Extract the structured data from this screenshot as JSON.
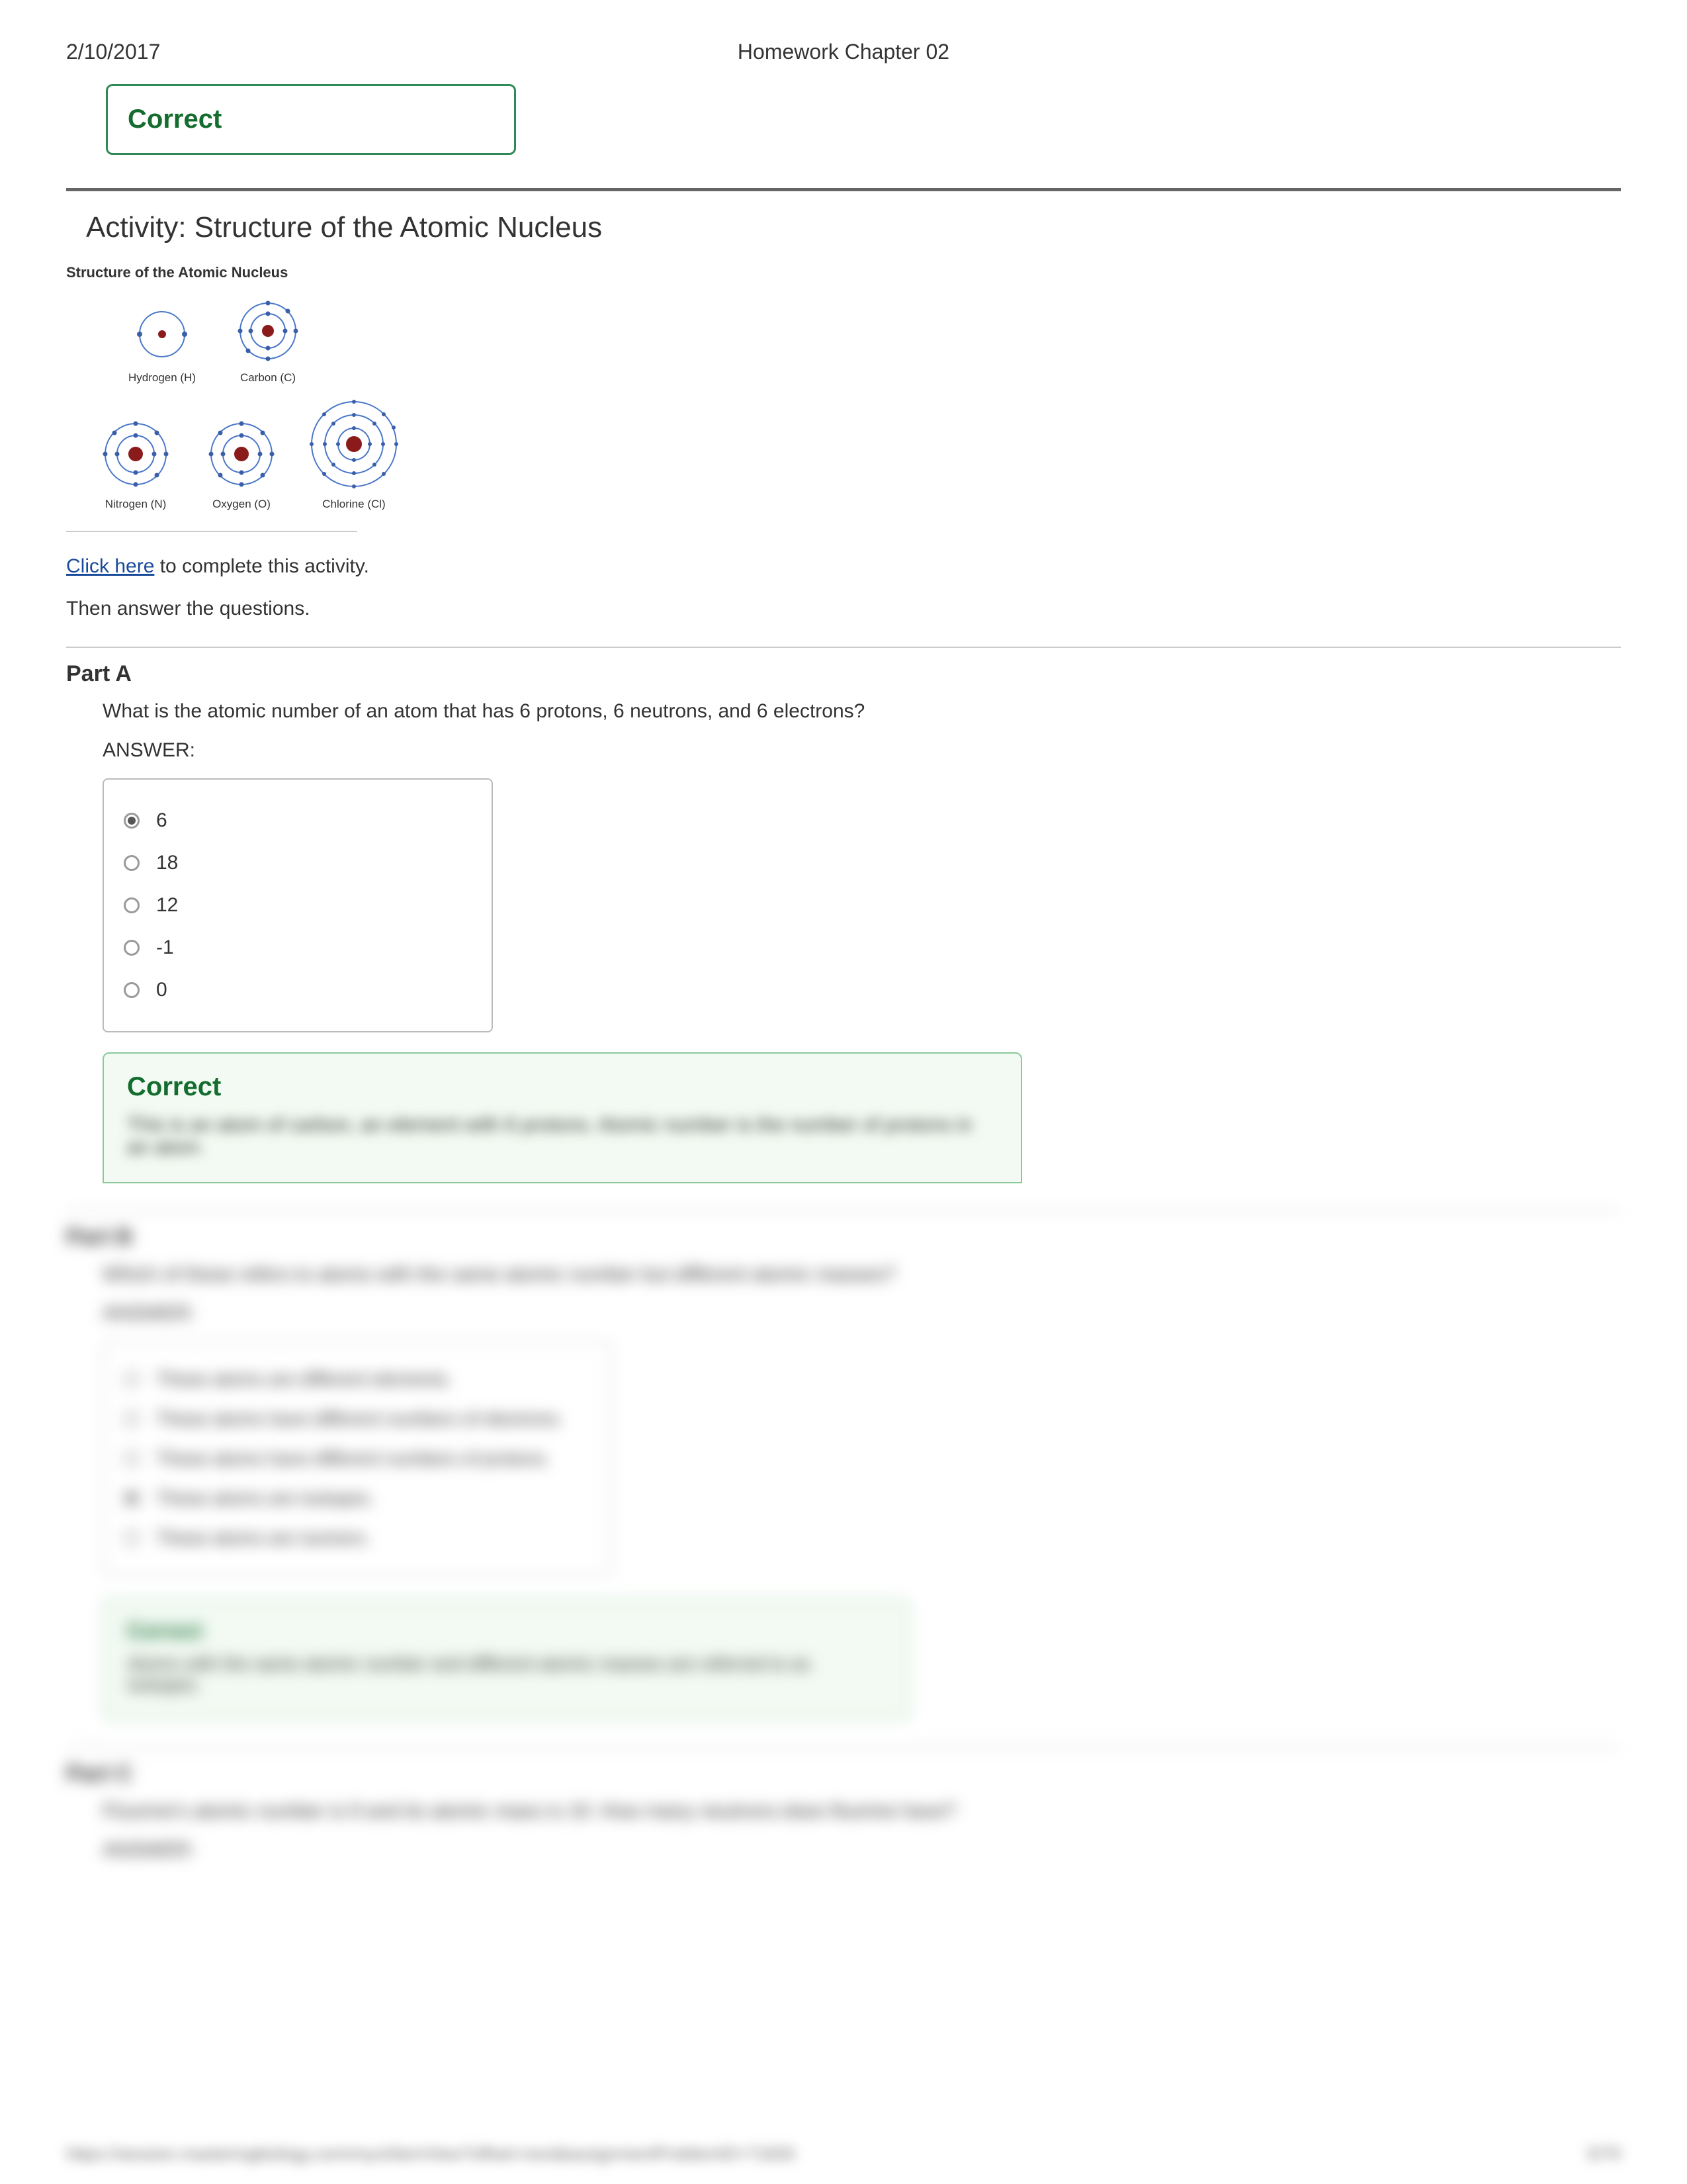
{
  "header": {
    "date": "2/10/2017",
    "title": "Homework Chapter 02"
  },
  "status_top": "Correct",
  "activity": {
    "title": "Activity: Structure of the Atomic Nucleus",
    "diagram_title": "Structure of the Atomic Nucleus",
    "atoms": {
      "h": "Hydrogen (H)",
      "c": "Carbon (C)",
      "n": "Nitrogen (N)",
      "o": "Oxygen (O)",
      "cl": "Chlorine (Cl)"
    },
    "link": "Click here",
    "link_tail": " to complete this activity.",
    "instr2": "Then answer the questions."
  },
  "partA": {
    "label": "Part A",
    "question": "What is the atomic number of an atom that has 6 protons, 6 neutrons, and 6 electrons?",
    "answer_label": "ANSWER:",
    "options": [
      "6",
      "18",
      "12",
      "-1",
      "0"
    ],
    "feedback_title": "Correct",
    "feedback_text": "This is an atom of carbon, an element with 6 protons. Atomic number is the number of protons in an atom."
  },
  "partB": {
    "label": "Part B",
    "question": "Which of these refers to atoms with the same atomic number but different atomic masses?",
    "answer_label": "ANSWER:",
    "options": [
      "These atoms are different elements.",
      "These atoms have different numbers of electrons.",
      "These atoms have different numbers of protons.",
      "These atoms are isotopes.",
      "These atoms are isomers."
    ],
    "feedback_title": "Correct",
    "feedback_text": "Atoms with the same atomic number and different atomic masses are referred to as isotopes."
  },
  "partC": {
    "label": "Part C",
    "question": "Fluorine's atomic number is 9 and its atomic mass is 19. How many neutrons does fluorine have?",
    "answer_label": "ANSWER:"
  },
  "footer": {
    "url": "https://session.masteringbiology.com/myct/itemView?offset=next&assignmentProblemID=71826",
    "page": "5/70"
  }
}
